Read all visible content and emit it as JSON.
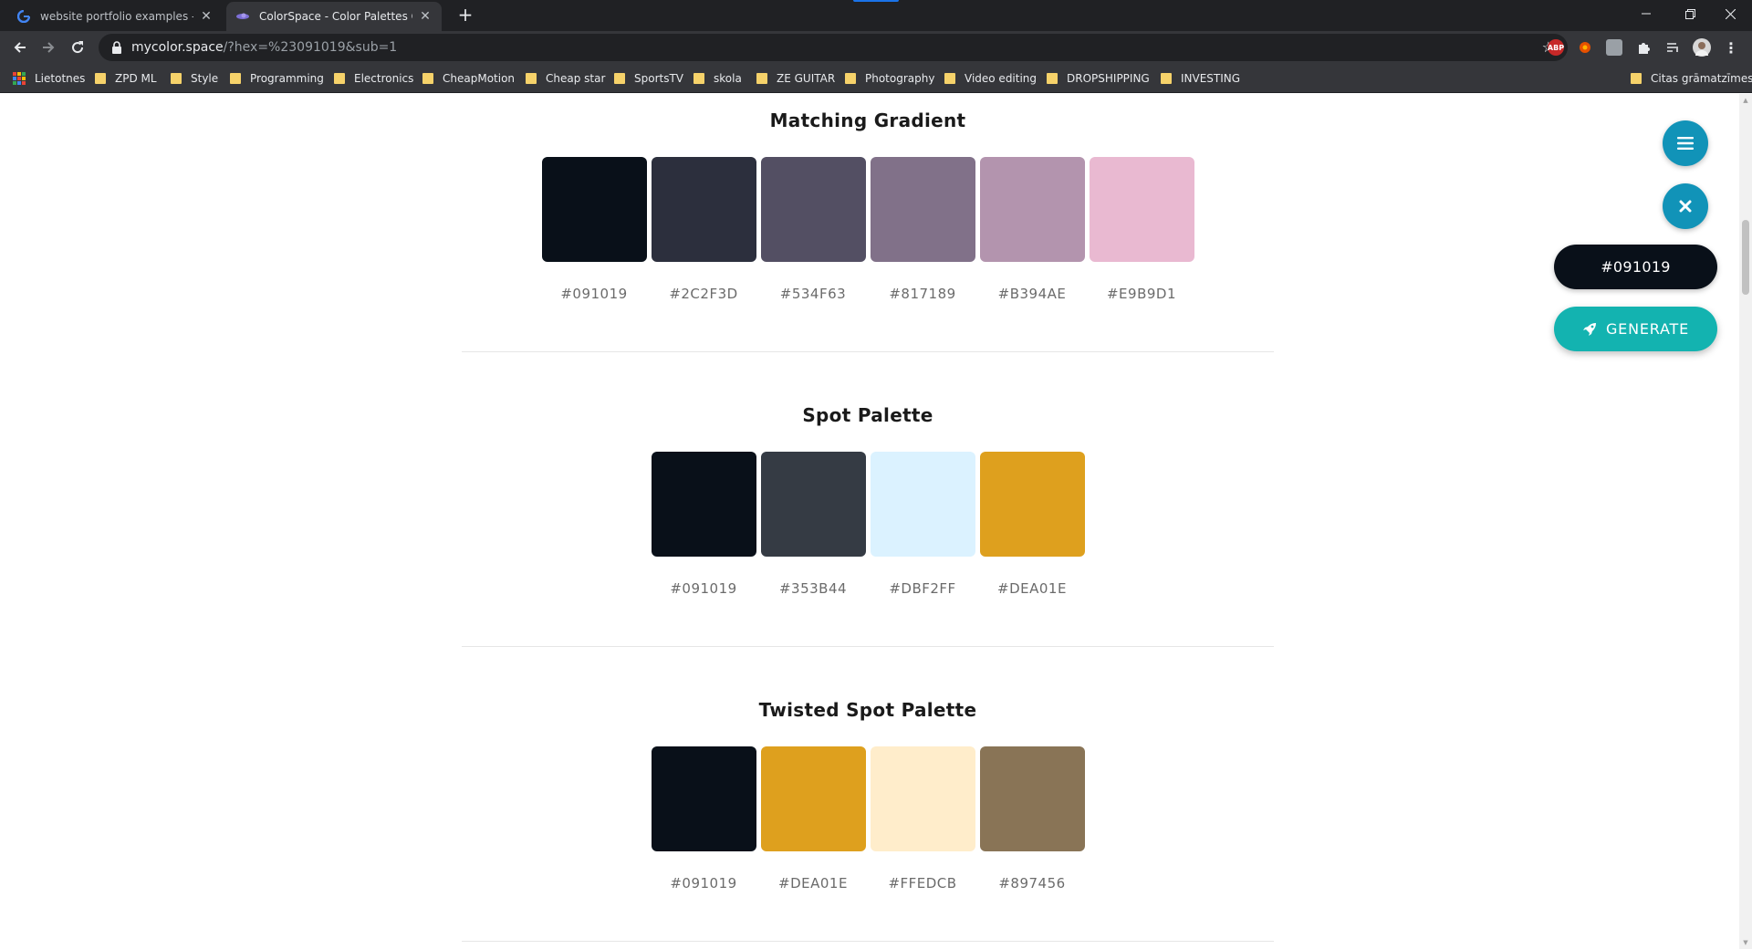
{
  "browser": {
    "tabs": [
      {
        "title": "website portfolio examples - Goo",
        "active": false,
        "icon": "google-icon"
      },
      {
        "title": "ColorSpace - Color Palettes Gene",
        "active": true,
        "icon": "colorspace-icon"
      }
    ],
    "new_tab_label": "+",
    "url_host": "mycolor.space",
    "url_path": "/?hex=%23091019&sub=1",
    "bookmarks": [
      {
        "label": "Lietotnes",
        "type": "apps"
      },
      {
        "label": "ZPD ML",
        "type": "folder"
      },
      {
        "label": "Style",
        "type": "folder"
      },
      {
        "label": "Programming",
        "type": "folder"
      },
      {
        "label": "Electronics",
        "type": "folder"
      },
      {
        "label": "CheapMotion",
        "type": "folder"
      },
      {
        "label": "Cheap star",
        "type": "folder"
      },
      {
        "label": "SportsTV",
        "type": "folder"
      },
      {
        "label": "skola",
        "type": "folder"
      },
      {
        "label": "ZE GUITAR",
        "type": "folder"
      },
      {
        "label": "Photography",
        "type": "folder"
      },
      {
        "label": "Video editing",
        "type": "folder"
      },
      {
        "label": "DROPSHIPPING",
        "type": "folder"
      },
      {
        "label": "INVESTING",
        "type": "folder"
      }
    ],
    "other_bookmarks": "Citas grāmatzīmes",
    "extensions": [
      "abp-icon",
      "honey-icon",
      "extension-icon",
      "puzzle-icon",
      "media-icon",
      "profile-avatar"
    ]
  },
  "palettes": [
    {
      "title": "Matching Gradient",
      "colors": [
        {
          "hex": "#091019",
          "label": "#091019"
        },
        {
          "hex": "#2C2F3D",
          "label": "#2C2F3D"
        },
        {
          "hex": "#534F63",
          "label": "#534F63"
        },
        {
          "hex": "#817189",
          "label": "#817189"
        },
        {
          "hex": "#B394AE",
          "label": "#B394AE"
        },
        {
          "hex": "#E9B9D1",
          "label": "#E9B9D1"
        }
      ]
    },
    {
      "title": "Spot Palette",
      "colors": [
        {
          "hex": "#091019",
          "label": "#091019"
        },
        {
          "hex": "#353B44",
          "label": "#353B44"
        },
        {
          "hex": "#DBF2FF",
          "label": "#DBF2FF"
        },
        {
          "hex": "#DEA01E",
          "label": "#DEA01E"
        }
      ]
    },
    {
      "title": "Twisted Spot Palette",
      "colors": [
        {
          "hex": "#091019",
          "label": "#091019"
        },
        {
          "hex": "#DEA01E",
          "label": "#DEA01E"
        },
        {
          "hex": "#FFEDCB",
          "label": "#FFEDCB"
        },
        {
          "hex": "#897456",
          "label": "#897456"
        }
      ]
    }
  ],
  "controls": {
    "current_hex": "#091019",
    "generate_label": "GENERATE",
    "menu_icon": "menu-icon",
    "close_icon": "close-icon",
    "generate_icon": "rocket-icon"
  },
  "colors": {
    "accent": "#1193B8",
    "generate": "#13B3B0",
    "base": "#091019"
  }
}
